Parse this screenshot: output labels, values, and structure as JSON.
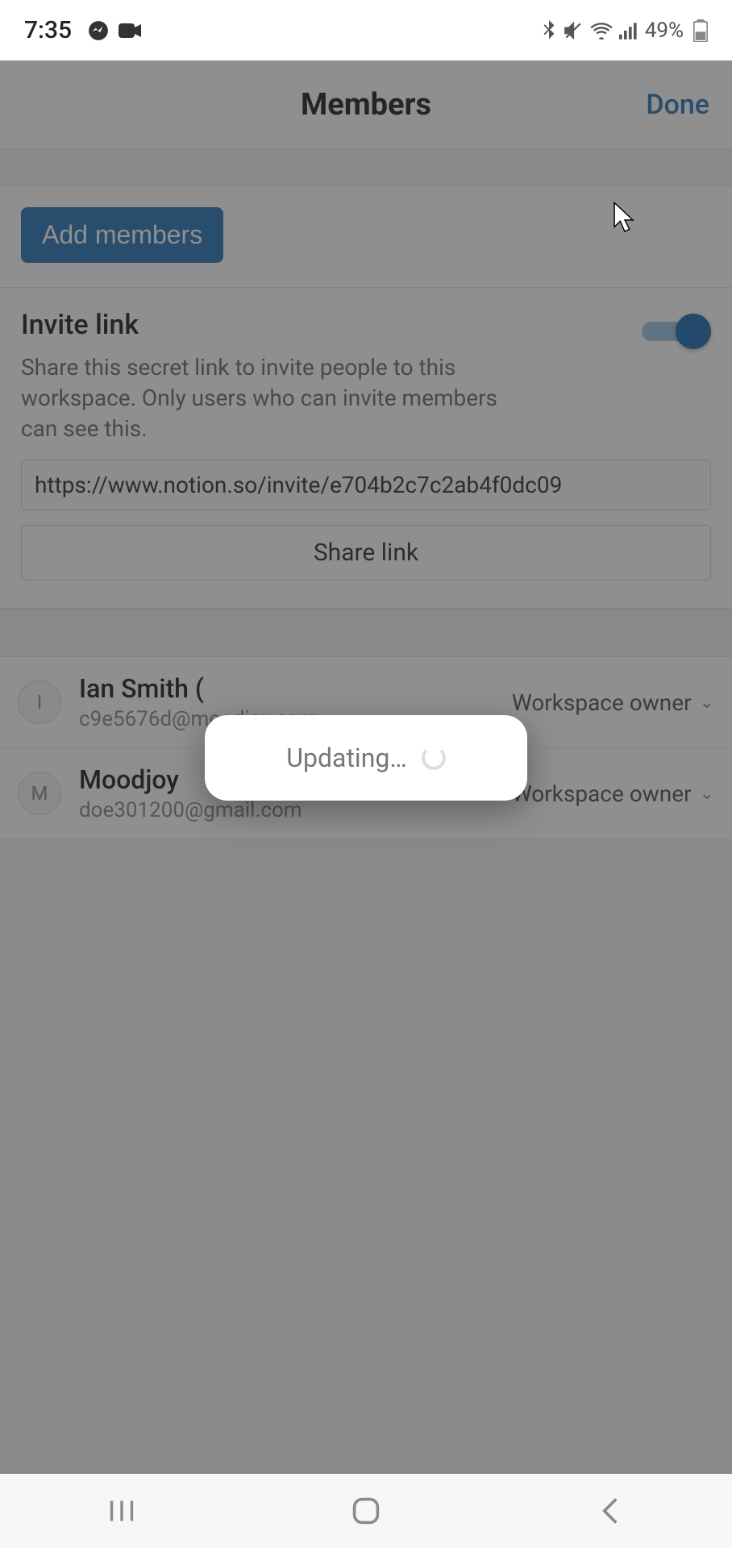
{
  "status": {
    "time": "7:35",
    "battery": "49%"
  },
  "header": {
    "title": "Members",
    "done": "Done"
  },
  "add_members": {
    "button": "Add members"
  },
  "invite": {
    "title": "Invite link",
    "description": "Share this secret link to invite people to this workspace. Only users who can invite members can see this.",
    "url": "https://www.notion.so/invite/e704b2c7c2ab4f0dc09",
    "share_button": "Share link",
    "toggle_on": true
  },
  "members": [
    {
      "initial": "I",
      "name": "Ian Smith (",
      "email": "c9e5676d@moodjoy.com",
      "role": "Workspace owner"
    },
    {
      "initial": "M",
      "name": "Moodjoy",
      "email": "doe301200@gmail.com",
      "role": "Workspace owner"
    }
  ],
  "modal": {
    "text": "Updating…"
  }
}
